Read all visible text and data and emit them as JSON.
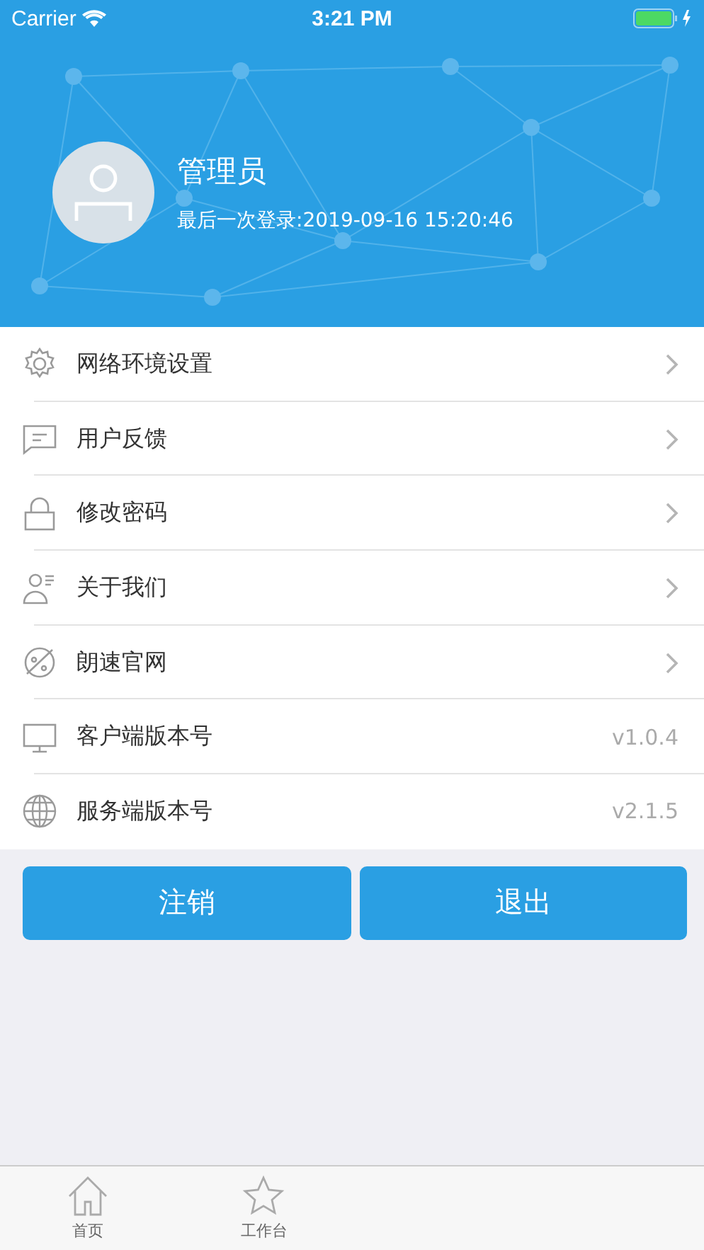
{
  "status_bar": {
    "carrier": "Carrier",
    "time": "3:21 PM"
  },
  "profile": {
    "name": "管理员",
    "last_login": "最后一次登录:2019-09-16 15:20:46"
  },
  "menu": [
    {
      "kind": "link",
      "label": "网络环境设置"
    },
    {
      "kind": "link",
      "label": "用户反馈"
    },
    {
      "kind": "link",
      "label": "修改密码"
    },
    {
      "kind": "link",
      "label": "关于我们"
    },
    {
      "kind": "link",
      "label": "朗速官网"
    },
    {
      "kind": "version",
      "label": "客户端版本号",
      "value": "v1.0.4"
    },
    {
      "kind": "version",
      "label": "服务端版本号",
      "value": "v2.1.5"
    }
  ],
  "buttons": [
    "注销",
    "退出"
  ],
  "tab_bar": [
    {
      "label": "首页",
      "selected": false
    },
    {
      "label": "工作台",
      "selected": false
    }
  ]
}
